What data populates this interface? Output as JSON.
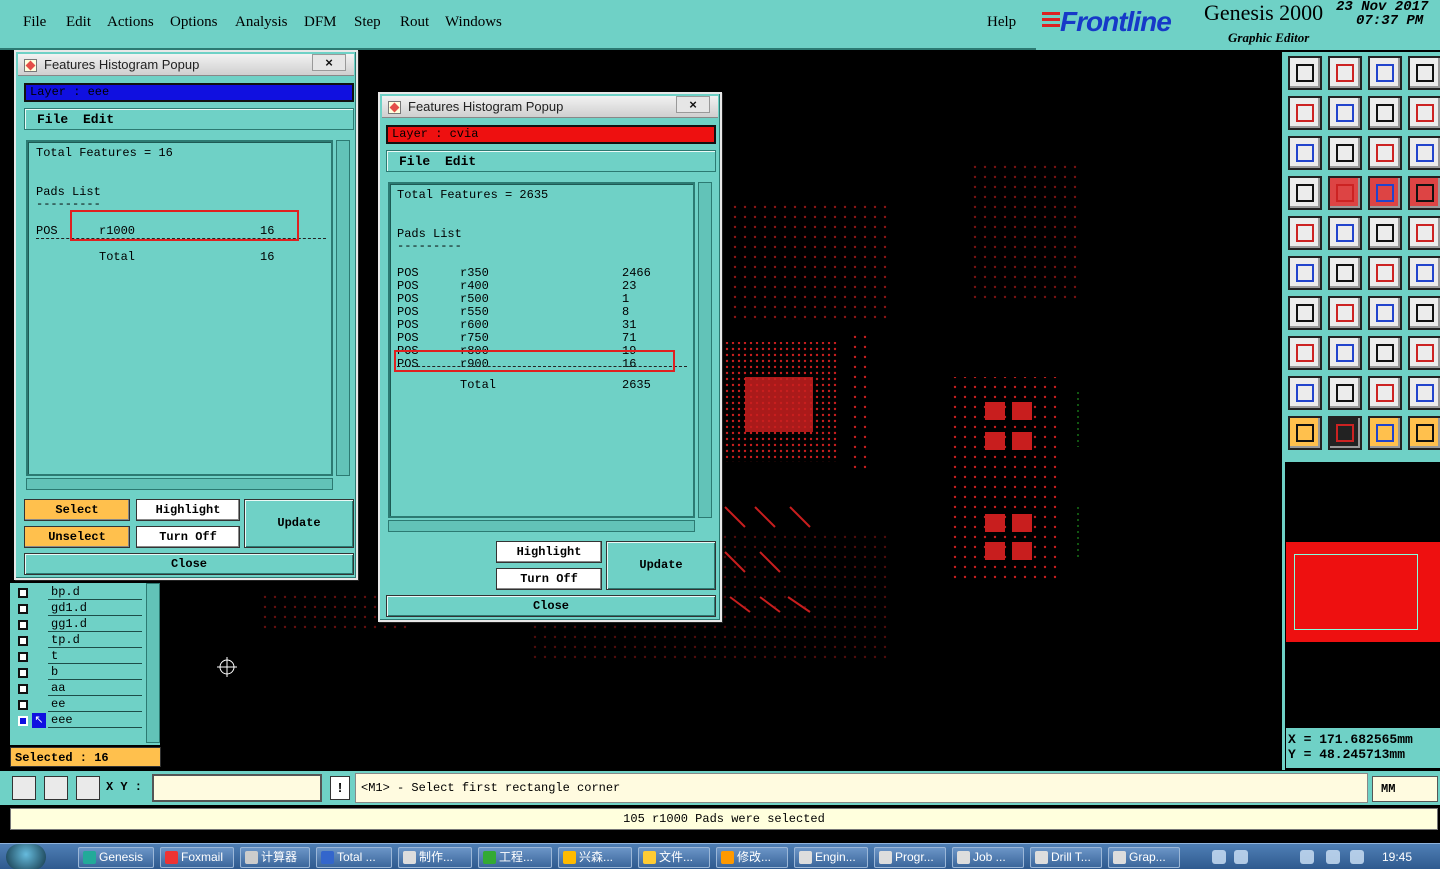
{
  "menubar": {
    "items": [
      "File",
      "Edit",
      "Actions",
      "Options",
      "Analysis",
      "DFM",
      "Step",
      "Rout",
      "Windows"
    ],
    "help": "Help"
  },
  "brand": {
    "logo": "Frontline",
    "product": "Genesis 2000",
    "subtitle": "Graphic Editor",
    "date": "23 Nov 2017",
    "time": "07:37 PM"
  },
  "popup1": {
    "title": "Features Histogram Popup",
    "close_label": "×",
    "layer_label": "Layer :  eee",
    "menu": [
      "File",
      "Edit"
    ],
    "total": "Total Features = 16",
    "pads_heading": "Pads List",
    "dash": "---------",
    "rows": [
      {
        "pos": "POS",
        "sym": "r1000",
        "count": "16"
      }
    ],
    "total_label": "Total",
    "total_count": "16",
    "buttons": {
      "select": "Select",
      "unselect": "Unselect",
      "highlight": "Highlight",
      "turn_off": "Turn Off",
      "update": "Update",
      "close": "Close"
    },
    "layer_color": "#1010e0"
  },
  "popup2": {
    "title": "Features Histogram Popup",
    "close_label": "×",
    "layer_label": "Layer :  cvia",
    "menu": [
      "File",
      "Edit"
    ],
    "total": "Total Features = 2635",
    "pads_heading": "Pads List",
    "dash": "---------",
    "rows": [
      {
        "pos": "POS",
        "sym": "r350",
        "count": "2466"
      },
      {
        "pos": "POS",
        "sym": "r400",
        "count": "23"
      },
      {
        "pos": "POS",
        "sym": "r500",
        "count": "1"
      },
      {
        "pos": "POS",
        "sym": "r550",
        "count": "8"
      },
      {
        "pos": "POS",
        "sym": "r600",
        "count": "31"
      },
      {
        "pos": "POS",
        "sym": "r750",
        "count": "71"
      },
      {
        "pos": "POS",
        "sym": "r800",
        "count": "19"
      },
      {
        "pos": "POS",
        "sym": "r900",
        "count": "16"
      }
    ],
    "total_label": "Total",
    "total_count": "2635",
    "buttons": {
      "highlight": "Highlight",
      "turn_off": "Turn Off",
      "update": "Update",
      "close": "Close"
    },
    "layer_color": "#ee1010"
  },
  "layers": {
    "items": [
      "bp.d",
      "gd1.d",
      "gg1.d",
      "tp.d",
      "t",
      "b",
      "aa",
      "ee",
      "eee"
    ]
  },
  "selected_status": "Selected : 16",
  "command": {
    "xy_label": "X Y :",
    "xy_value": "",
    "excl": "!",
    "prompt": "<M1> - Select first rectangle corner",
    "units": "MM"
  },
  "status_message": "105 r1000 Pads were selected",
  "coords": {
    "x": "X = 171.682565mm",
    "y": "Y = 48.245713mm"
  },
  "taskbar": {
    "items": [
      "Genesis",
      "Foxmail",
      "计算器",
      "Total ...",
      "制作...",
      "工程...",
      "兴森...",
      "文件...",
      "修改...",
      "Engin...",
      "Progr...",
      "Job ...",
      "Drill T...",
      "Grap..."
    ],
    "clock": "19:45"
  },
  "colors": {
    "teal": "#6fd1c6",
    "accent_yellow": "#ffc04d",
    "highlight_red": "#e02020",
    "pad_red": "#c81e1e"
  }
}
